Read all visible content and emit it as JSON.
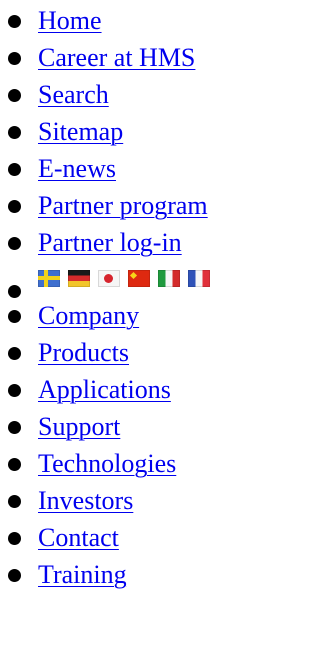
{
  "top_menu": {
    "items": [
      {
        "label": "Home"
      },
      {
        "label": "Career at HMS"
      },
      {
        "label": "Search"
      },
      {
        "label": "Sitemap"
      },
      {
        "label": "E-news"
      },
      {
        "label": "Partner program"
      },
      {
        "label": "Partner log-in"
      }
    ],
    "languages": [
      {
        "flag": "sweden-flag",
        "colors": [
          "#3f6fcf",
          "#f2d21b"
        ]
      },
      {
        "flag": "germany-flag",
        "colors": [
          "#1a1a1a",
          "#d62b2b",
          "#f2c52b"
        ]
      },
      {
        "flag": "japan-flag",
        "colors": [
          "#f6f6f6",
          "#d6242d"
        ]
      },
      {
        "flag": "china-flag",
        "colors": [
          "#de2910",
          "#f7d418"
        ]
      },
      {
        "flag": "italy-flag",
        "colors": [
          "#1f9a3e",
          "#f6f6f6",
          "#d32b2b"
        ]
      },
      {
        "flag": "france-flag",
        "colors": [
          "#2f52b8",
          "#f6f6f6",
          "#e0303a"
        ]
      }
    ]
  },
  "main_menu": {
    "items": [
      {
        "label": "Company"
      },
      {
        "label": "Products"
      },
      {
        "label": "Applications"
      },
      {
        "label": "Support"
      },
      {
        "label": "Technologies"
      },
      {
        "label": "Investors"
      },
      {
        "label": "Contact"
      },
      {
        "label": "Training"
      }
    ]
  },
  "colors": {
    "link": "#0000ee",
    "bullet": "#000000",
    "background": "#ffffff"
  }
}
